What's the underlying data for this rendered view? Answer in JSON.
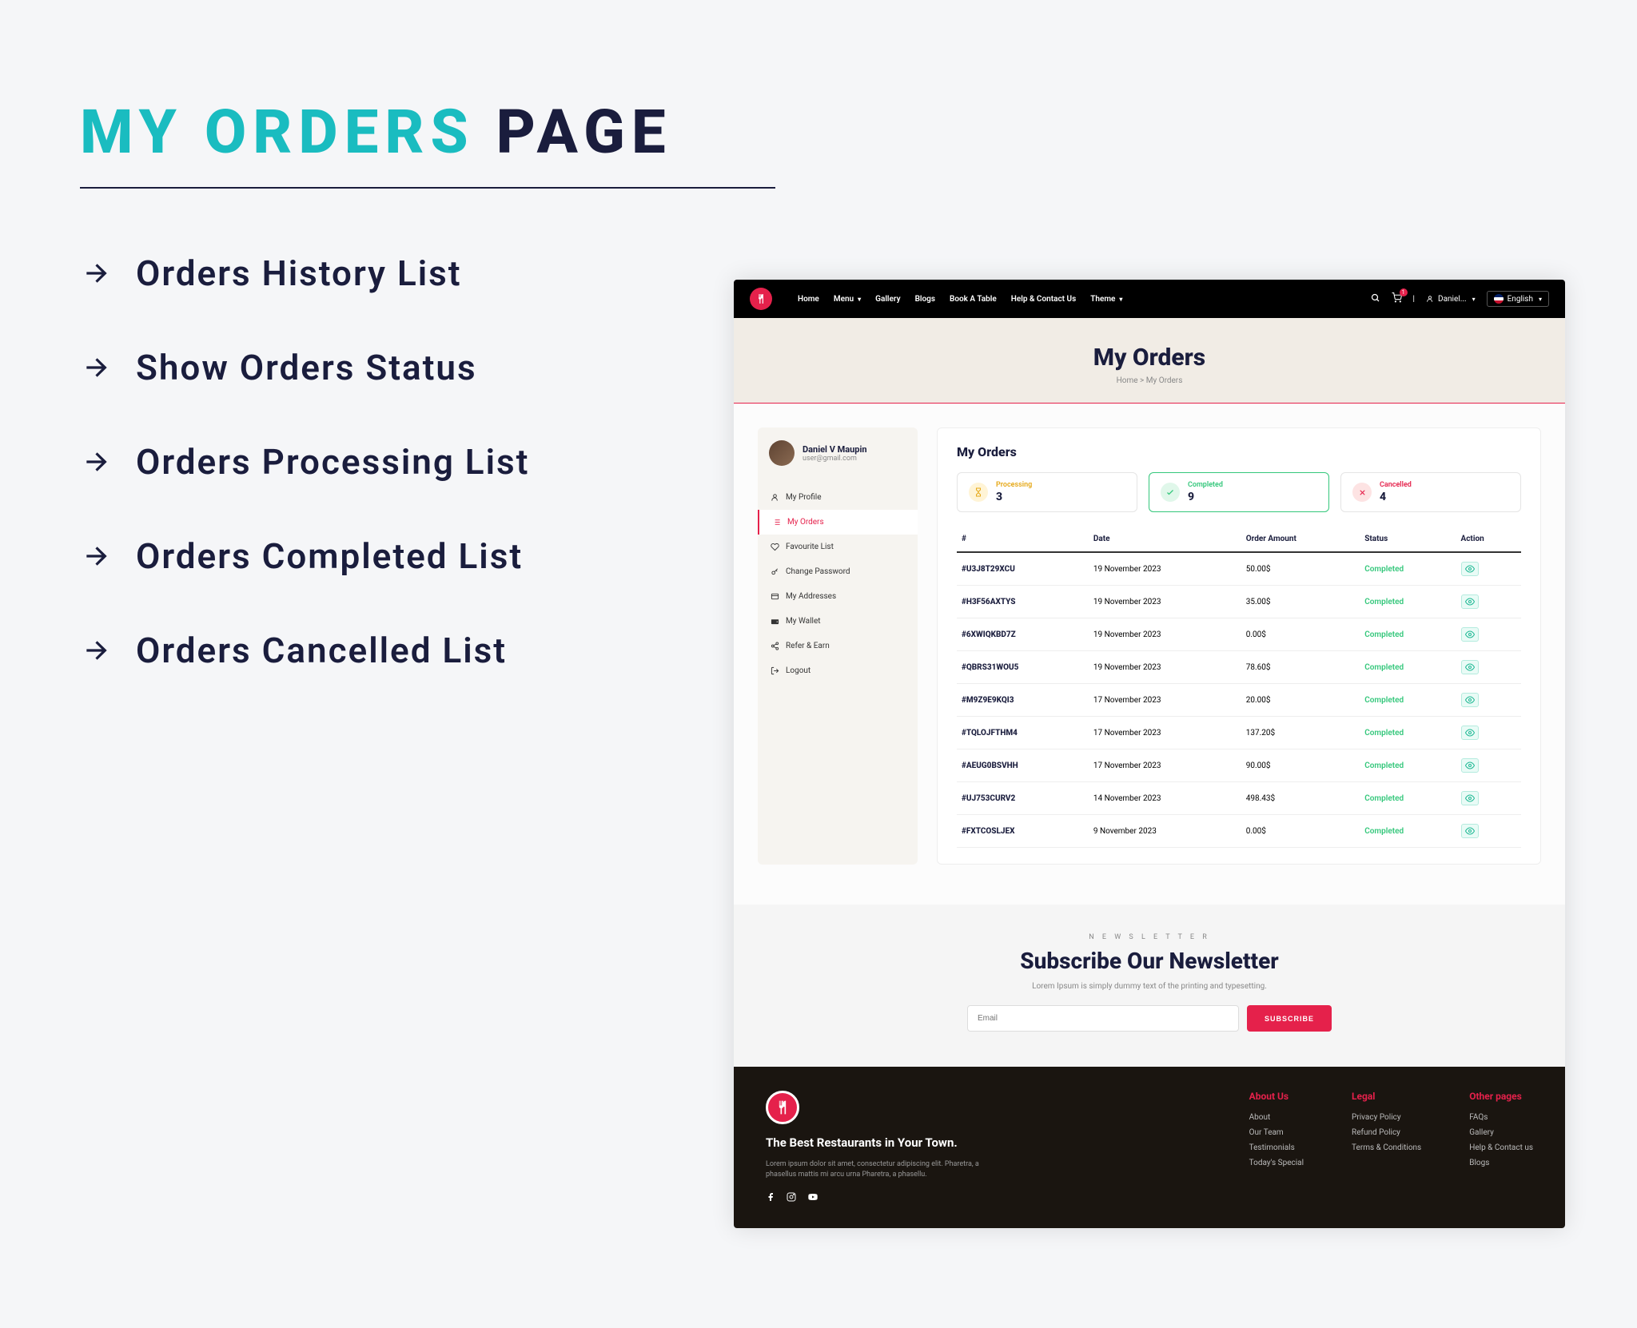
{
  "slide": {
    "title_teal": "MY ORDERS",
    "title_dark": "PAGE",
    "features": [
      "Orders History List",
      "Show Orders Status",
      "Orders Processing List",
      "Orders Completed List",
      "Orders Cancelled List"
    ]
  },
  "topbar": {
    "nav": [
      "Home",
      "Menu",
      "Gallery",
      "Blogs",
      "Book A Table",
      "Help & Contact Us",
      "Theme"
    ],
    "cart_count": "1",
    "user": "Daniel...",
    "language": "English"
  },
  "hero": {
    "title": "My Orders",
    "crumb_home": "Home",
    "crumb_sep": ">",
    "crumb_current": "My Orders"
  },
  "sidebar": {
    "name": "Daniel V Maupin",
    "email": "user@gmail.com",
    "items": [
      {
        "label": "My Profile",
        "icon": "user"
      },
      {
        "label": "My Orders",
        "icon": "list",
        "active": true
      },
      {
        "label": "Favourite List",
        "icon": "heart"
      },
      {
        "label": "Change Password",
        "icon": "key"
      },
      {
        "label": "My Addresses",
        "icon": "map"
      },
      {
        "label": "My Wallet",
        "icon": "wallet"
      },
      {
        "label": "Refer & Earn",
        "icon": "share"
      },
      {
        "label": "Logout",
        "icon": "logout"
      }
    ]
  },
  "main": {
    "title": "My Orders",
    "statuses": {
      "processing": {
        "label": "Processing",
        "count": "3"
      },
      "completed": {
        "label": "Completed",
        "count": "9"
      },
      "cancelled": {
        "label": "Cancelled",
        "count": "4"
      }
    },
    "columns": [
      "#",
      "Date",
      "Order Amount",
      "Status",
      "Action"
    ],
    "rows": [
      {
        "id": "#U3J8T29XCU",
        "date": "19 November 2023",
        "amount": "50.00$",
        "status": "Completed"
      },
      {
        "id": "#H3F56AXTYS",
        "date": "19 November 2023",
        "amount": "35.00$",
        "status": "Completed"
      },
      {
        "id": "#6XWIQKBD7Z",
        "date": "19 November 2023",
        "amount": "0.00$",
        "status": "Completed"
      },
      {
        "id": "#QBRS31WOU5",
        "date": "19 November 2023",
        "amount": "78.60$",
        "status": "Completed"
      },
      {
        "id": "#M9Z9E9KQI3",
        "date": "17 November 2023",
        "amount": "20.00$",
        "status": "Completed"
      },
      {
        "id": "#TQLOJFTHM4",
        "date": "17 November 2023",
        "amount": "137.20$",
        "status": "Completed"
      },
      {
        "id": "#AEUG0BSVHH",
        "date": "17 November 2023",
        "amount": "90.00$",
        "status": "Completed"
      },
      {
        "id": "#UJ753CURV2",
        "date": "14 November 2023",
        "amount": "498.43$",
        "status": "Completed"
      },
      {
        "id": "#FXTCOSLJEX",
        "date": "9 November 2023",
        "amount": "0.00$",
        "status": "Completed"
      }
    ]
  },
  "newsletter": {
    "tag": "N E W S L E T T E R",
    "title": "Subscribe Our Newsletter",
    "sub": "Lorem Ipsum is simply dummy text of the printing and typesetting.",
    "placeholder": "Email",
    "button": "SUBSCRIBE"
  },
  "footer": {
    "tagline": "The Best Restaurants in Your Town.",
    "desc": "Lorem ipsum dolor sit amet, consectetur adipiscing elit. Pharetra, a phasellus mattis mi arcu urna Pharetra, a phasellu.",
    "cols": [
      {
        "title": "About Us",
        "links": [
          "About",
          "Our Team",
          "Testimonials",
          "Today's Special"
        ]
      },
      {
        "title": "Legal",
        "links": [
          "Privacy Policy",
          "Refund Policy",
          "Terms & Conditions"
        ]
      },
      {
        "title": "Other pages",
        "links": [
          "FAQs",
          "Gallery",
          "Help & Contact us",
          "Blogs"
        ]
      }
    ]
  }
}
